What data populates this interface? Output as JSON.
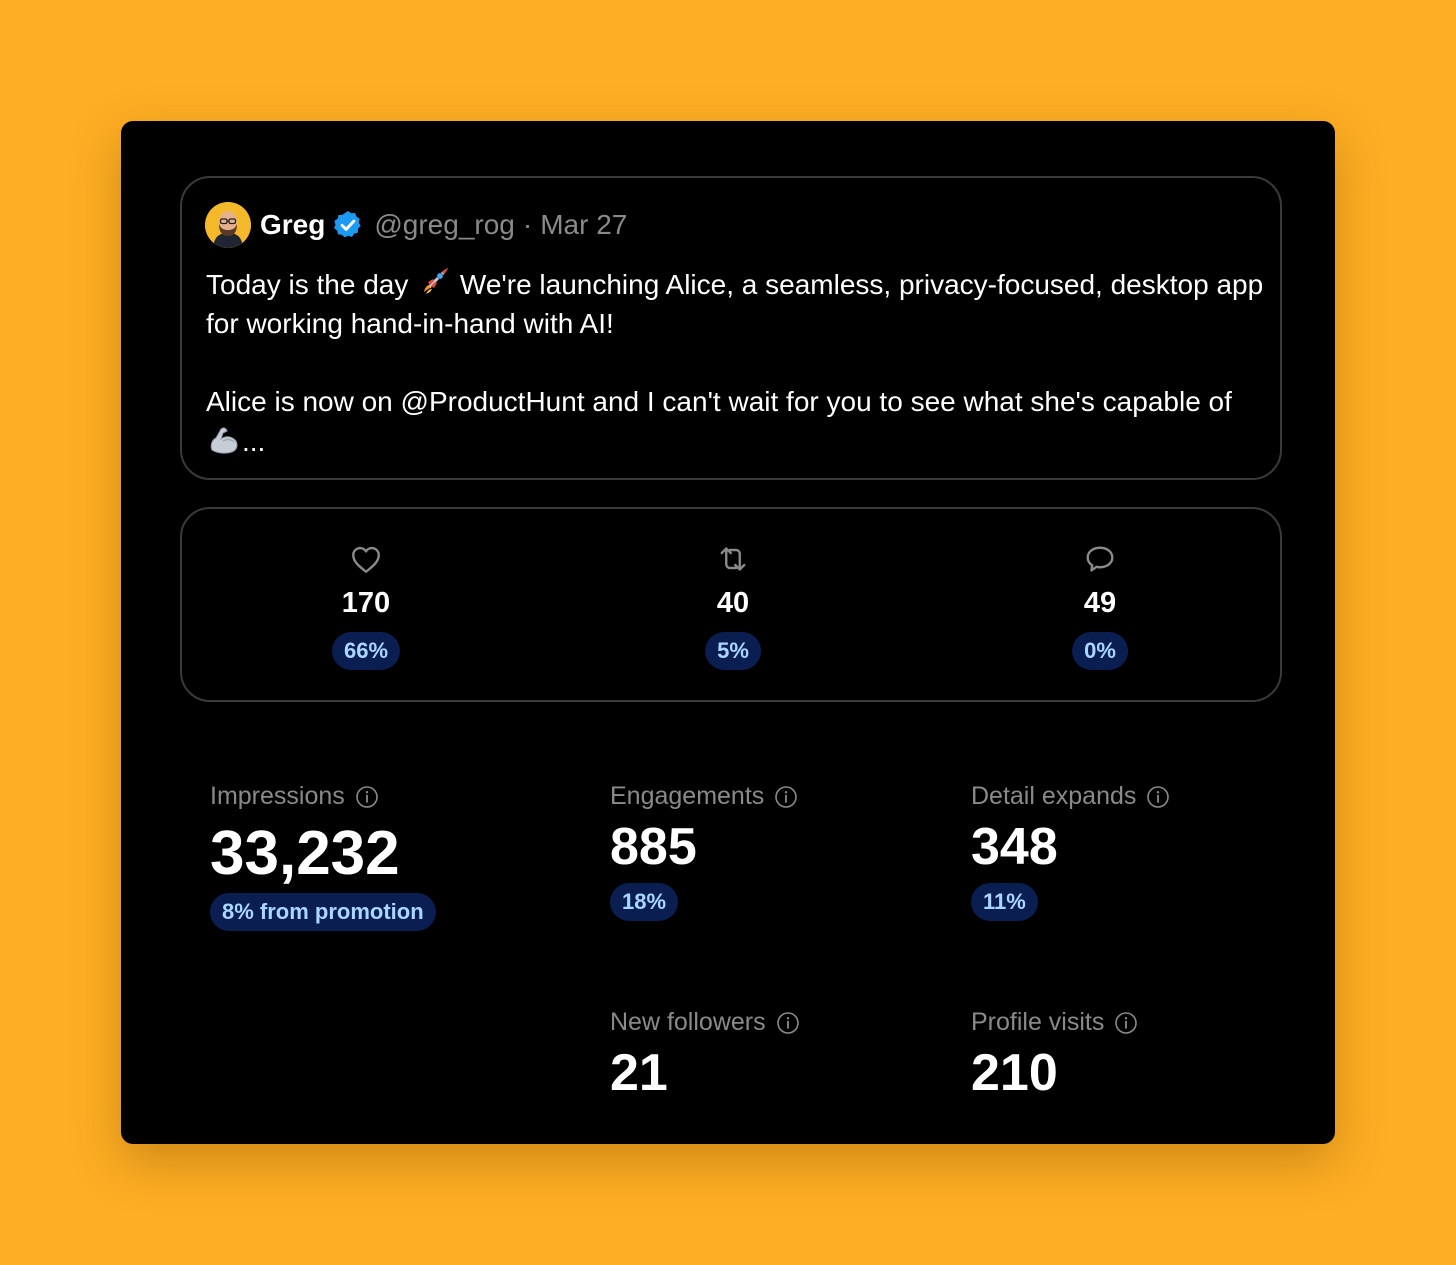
{
  "tweet": {
    "author_name": "Greg",
    "handle": "@greg_rog",
    "separator": "·",
    "date": "Mar 27",
    "line1_pre": "Today is the day",
    "line1_post": "We're launching Alice, a seamless, privacy-focused, desktop app for working hand-in-hand with AI!",
    "line2_pre": "Alice is now on @ProductHunt and I can't wait for you to see what she's capable of",
    "line2_post": "...",
    "emoji_1": "rocket-icon",
    "emoji_2": "flexed-biceps-icon"
  },
  "actions": [
    {
      "icon": "heart-icon",
      "count": "170",
      "percent": "66%"
    },
    {
      "icon": "retweet-icon",
      "count": "40",
      "percent": "5%"
    },
    {
      "icon": "comment-icon",
      "count": "49",
      "percent": "0%"
    }
  ],
  "stats": {
    "impressions": {
      "label": "Impressions",
      "value": "33,232",
      "badge": "8% from promotion"
    },
    "engagements": {
      "label": "Engagements",
      "value": "885",
      "badge": "18%"
    },
    "detail_expands": {
      "label": "Detail expands",
      "value": "348",
      "badge": "11%"
    },
    "new_followers": {
      "label": "New followers",
      "value": "21"
    },
    "profile_visits": {
      "label": "Profile visits",
      "value": "210"
    }
  },
  "colors": {
    "background": "#FDAE23",
    "card": "#000000",
    "pill_bg": "#0A1E52",
    "pill_text": "#A9D7FF",
    "verified": "#1D9BF0",
    "muted_text": "#8a8a8a"
  }
}
